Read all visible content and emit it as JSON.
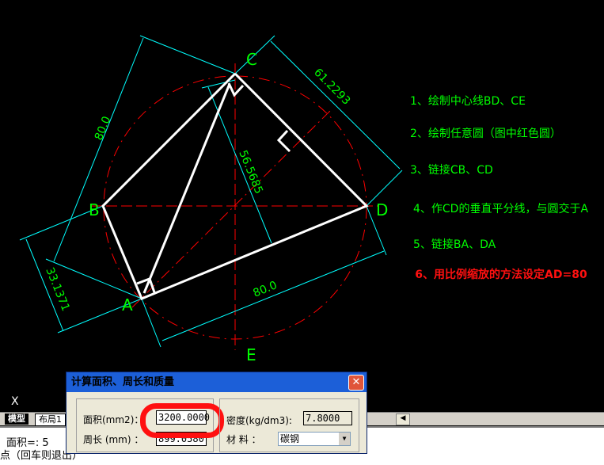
{
  "labels": {
    "C": "C",
    "D": "D",
    "B": "B",
    "A": "A",
    "E": "E"
  },
  "dimensions": {
    "bc": "80.0",
    "cd": "61.2293",
    "height": "56.5685",
    "ad": "80.0",
    "ab": "33.1371"
  },
  "steps": [
    "1、绘制中心线BD、CE",
    "2、绘制任意圆（图中红色圆）",
    "3、链接CB、CD",
    "4、作CD的垂直平分线，与圆交于A",
    "5、链接BA、DA"
  ],
  "step6": "6、用比例缩放的方法设定AD=80",
  "tabs": [
    "模型",
    "布局1"
  ],
  "command": {
    "line1": "面积=:     5",
    "line2": "点（回车则退出）",
    "prompt": "X"
  },
  "dialog": {
    "title": "计算面积、周长和质量",
    "area_label": "面积(mm2)：",
    "area_value": "3200.0000",
    "perimeter_label": "周长 (mm) ：",
    "perimeter_value": "899.0580",
    "density_label": "密度(kg/dm3):",
    "density_value": "7.8000",
    "material_label": "材 料  ：",
    "material_value": "碳钢"
  },
  "colors": {
    "dimension": "#00ffff",
    "text": "#00ff00",
    "centerline": "#ff0000",
    "geometry": "#ffffff"
  }
}
